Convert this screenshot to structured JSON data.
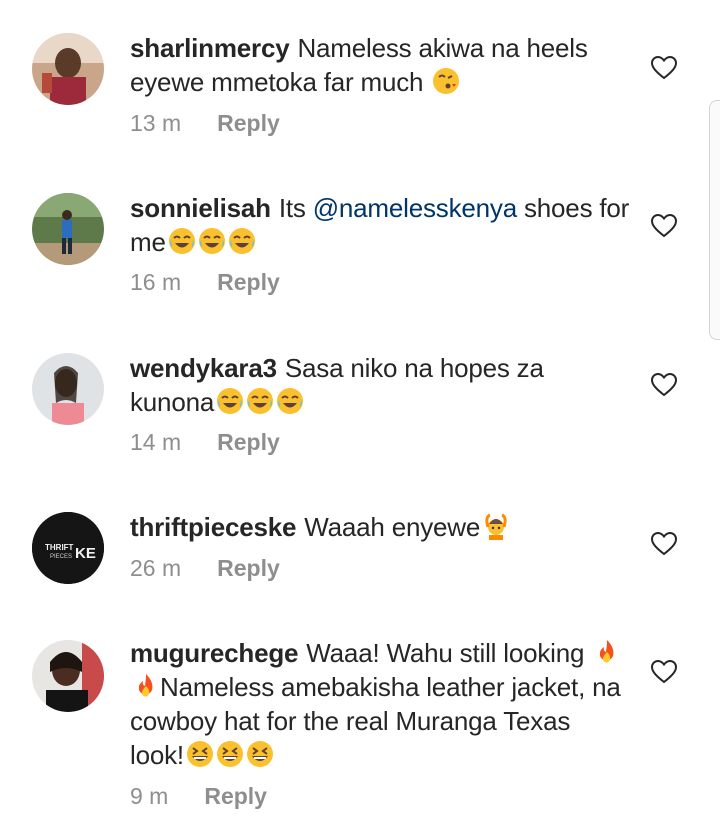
{
  "comments": [
    {
      "username": "sharlinmercy",
      "text": "Nameless akiwa na heels eyewe mmetoka far much",
      "emoji": "face-blowing-kiss",
      "time": "13 m",
      "reply": "Reply"
    },
    {
      "username": "sonnielisah",
      "text_before": "Its ",
      "mention": "@namelesskenya",
      "text_after": " shoes for me",
      "emoji": "face-with-tears-of-joy x3",
      "time": "16 m",
      "reply": "Reply"
    },
    {
      "username": "wendykara3",
      "text": "Sasa niko na hopes za kunona",
      "emoji": "face-with-tears-of-joy x3",
      "time": "14 m",
      "reply": "Reply"
    },
    {
      "username": "thriftpieceske",
      "text": "Waaah enyewe",
      "emoji": "person-raising-hands",
      "avatar_text": {
        "main": "THRIFT",
        "sub": "PIECES",
        "accent": "KE"
      },
      "time": "26 m",
      "reply": "Reply"
    },
    {
      "username": "mugurechege",
      "text_before": "Waaa! Wahu still looking",
      "text_after": "Nameless amebakisha leather jacket, na cowboy hat for the real Muranga Texas look!",
      "emoji": "fire x2, grinning-squinting-face x3",
      "time": "9 m",
      "reply": "Reply"
    }
  ],
  "colors": {
    "username": "#262626",
    "mention": "#003569",
    "meta": "#8e8e8e",
    "emoji_yellow": "#fbc02d"
  }
}
